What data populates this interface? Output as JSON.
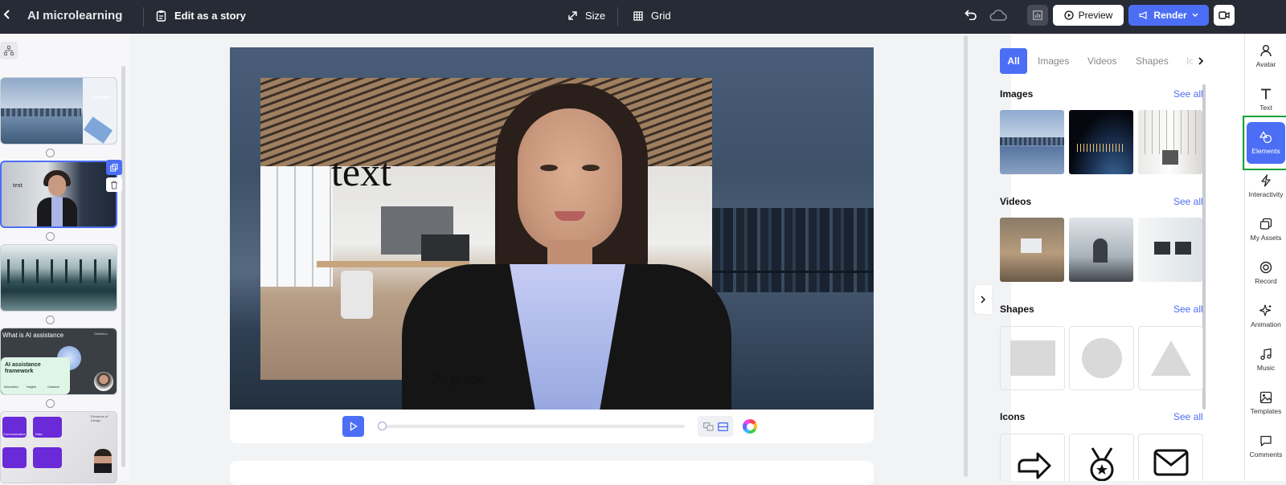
{
  "topbar": {
    "app_title": "AI microlearning",
    "edit_story": "Edit as a story",
    "size": "Size",
    "grid": "Grid",
    "preview": "Preview",
    "render": "Render"
  },
  "canvas": {
    "text_element": "text",
    "caption": "AI guide"
  },
  "slides": {
    "slide1_logo": "Panopto",
    "slide4_heading": "What is AI assistance",
    "slide4_title": "AI assistance framework",
    "slide4_tag": "Definition",
    "slide4_items": [
      "Automation",
      "Insights",
      "Guidance"
    ],
    "slide5_title": "Elements of Design",
    "slide5_labels": [
      "Communication",
      "Data"
    ]
  },
  "panel": {
    "tabs": [
      "All",
      "Images",
      "Videos",
      "Shapes",
      "Icons"
    ],
    "active_tab": "All",
    "sections": {
      "images": "Images",
      "videos": "Videos",
      "shapes": "Shapes",
      "icons": "Icons"
    },
    "see_all": "See all"
  },
  "nav": [
    {
      "label": "Avatar",
      "icon": "avatar-icon"
    },
    {
      "label": "Text",
      "icon": "text-icon"
    },
    {
      "label": "Elements",
      "icon": "elements-icon"
    },
    {
      "label": "Interactivity",
      "icon": "interactivity-icon"
    },
    {
      "label": "My Assets",
      "icon": "my-assets-icon"
    },
    {
      "label": "Record",
      "icon": "record-icon"
    },
    {
      "label": "Animation",
      "icon": "animation-icon"
    },
    {
      "label": "Music",
      "icon": "music-icon"
    },
    {
      "label": "Templates",
      "icon": "templates-icon"
    },
    {
      "label": "Comments",
      "icon": "comments-icon"
    }
  ],
  "colors": {
    "accent": "#4c6ef5",
    "topbar": "#272b35",
    "render_button": "#4c6ef5",
    "active_nav_outline": "#1aa33a"
  }
}
